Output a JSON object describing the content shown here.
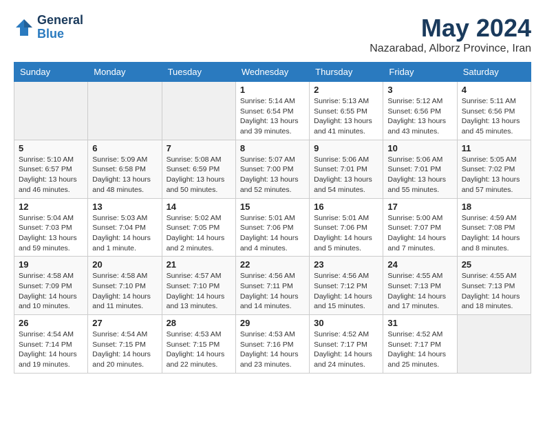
{
  "header": {
    "logo_line1": "General",
    "logo_line2": "Blue",
    "month": "May 2024",
    "location": "Nazarabad, Alborz Province, Iran"
  },
  "weekdays": [
    "Sunday",
    "Monday",
    "Tuesday",
    "Wednesday",
    "Thursday",
    "Friday",
    "Saturday"
  ],
  "weeks": [
    [
      {
        "day": "",
        "info": ""
      },
      {
        "day": "",
        "info": ""
      },
      {
        "day": "",
        "info": ""
      },
      {
        "day": "1",
        "info": "Sunrise: 5:14 AM\nSunset: 6:54 PM\nDaylight: 13 hours\nand 39 minutes."
      },
      {
        "day": "2",
        "info": "Sunrise: 5:13 AM\nSunset: 6:55 PM\nDaylight: 13 hours\nand 41 minutes."
      },
      {
        "day": "3",
        "info": "Sunrise: 5:12 AM\nSunset: 6:56 PM\nDaylight: 13 hours\nand 43 minutes."
      },
      {
        "day": "4",
        "info": "Sunrise: 5:11 AM\nSunset: 6:56 PM\nDaylight: 13 hours\nand 45 minutes."
      }
    ],
    [
      {
        "day": "5",
        "info": "Sunrise: 5:10 AM\nSunset: 6:57 PM\nDaylight: 13 hours\nand 46 minutes."
      },
      {
        "day": "6",
        "info": "Sunrise: 5:09 AM\nSunset: 6:58 PM\nDaylight: 13 hours\nand 48 minutes."
      },
      {
        "day": "7",
        "info": "Sunrise: 5:08 AM\nSunset: 6:59 PM\nDaylight: 13 hours\nand 50 minutes."
      },
      {
        "day": "8",
        "info": "Sunrise: 5:07 AM\nSunset: 7:00 PM\nDaylight: 13 hours\nand 52 minutes."
      },
      {
        "day": "9",
        "info": "Sunrise: 5:06 AM\nSunset: 7:01 PM\nDaylight: 13 hours\nand 54 minutes."
      },
      {
        "day": "10",
        "info": "Sunrise: 5:06 AM\nSunset: 7:01 PM\nDaylight: 13 hours\nand 55 minutes."
      },
      {
        "day": "11",
        "info": "Sunrise: 5:05 AM\nSunset: 7:02 PM\nDaylight: 13 hours\nand 57 minutes."
      }
    ],
    [
      {
        "day": "12",
        "info": "Sunrise: 5:04 AM\nSunset: 7:03 PM\nDaylight: 13 hours\nand 59 minutes."
      },
      {
        "day": "13",
        "info": "Sunrise: 5:03 AM\nSunset: 7:04 PM\nDaylight: 14 hours\nand 1 minute."
      },
      {
        "day": "14",
        "info": "Sunrise: 5:02 AM\nSunset: 7:05 PM\nDaylight: 14 hours\nand 2 minutes."
      },
      {
        "day": "15",
        "info": "Sunrise: 5:01 AM\nSunset: 7:06 PM\nDaylight: 14 hours\nand 4 minutes."
      },
      {
        "day": "16",
        "info": "Sunrise: 5:01 AM\nSunset: 7:06 PM\nDaylight: 14 hours\nand 5 minutes."
      },
      {
        "day": "17",
        "info": "Sunrise: 5:00 AM\nSunset: 7:07 PM\nDaylight: 14 hours\nand 7 minutes."
      },
      {
        "day": "18",
        "info": "Sunrise: 4:59 AM\nSunset: 7:08 PM\nDaylight: 14 hours\nand 8 minutes."
      }
    ],
    [
      {
        "day": "19",
        "info": "Sunrise: 4:58 AM\nSunset: 7:09 PM\nDaylight: 14 hours\nand 10 minutes."
      },
      {
        "day": "20",
        "info": "Sunrise: 4:58 AM\nSunset: 7:10 PM\nDaylight: 14 hours\nand 11 minutes."
      },
      {
        "day": "21",
        "info": "Sunrise: 4:57 AM\nSunset: 7:10 PM\nDaylight: 14 hours\nand 13 minutes."
      },
      {
        "day": "22",
        "info": "Sunrise: 4:56 AM\nSunset: 7:11 PM\nDaylight: 14 hours\nand 14 minutes."
      },
      {
        "day": "23",
        "info": "Sunrise: 4:56 AM\nSunset: 7:12 PM\nDaylight: 14 hours\nand 15 minutes."
      },
      {
        "day": "24",
        "info": "Sunrise: 4:55 AM\nSunset: 7:13 PM\nDaylight: 14 hours\nand 17 minutes."
      },
      {
        "day": "25",
        "info": "Sunrise: 4:55 AM\nSunset: 7:13 PM\nDaylight: 14 hours\nand 18 minutes."
      }
    ],
    [
      {
        "day": "26",
        "info": "Sunrise: 4:54 AM\nSunset: 7:14 PM\nDaylight: 14 hours\nand 19 minutes."
      },
      {
        "day": "27",
        "info": "Sunrise: 4:54 AM\nSunset: 7:15 PM\nDaylight: 14 hours\nand 20 minutes."
      },
      {
        "day": "28",
        "info": "Sunrise: 4:53 AM\nSunset: 7:15 PM\nDaylight: 14 hours\nand 22 minutes."
      },
      {
        "day": "29",
        "info": "Sunrise: 4:53 AM\nSunset: 7:16 PM\nDaylight: 14 hours\nand 23 minutes."
      },
      {
        "day": "30",
        "info": "Sunrise: 4:52 AM\nSunset: 7:17 PM\nDaylight: 14 hours\nand 24 minutes."
      },
      {
        "day": "31",
        "info": "Sunrise: 4:52 AM\nSunset: 7:17 PM\nDaylight: 14 hours\nand 25 minutes."
      },
      {
        "day": "",
        "info": ""
      }
    ]
  ]
}
